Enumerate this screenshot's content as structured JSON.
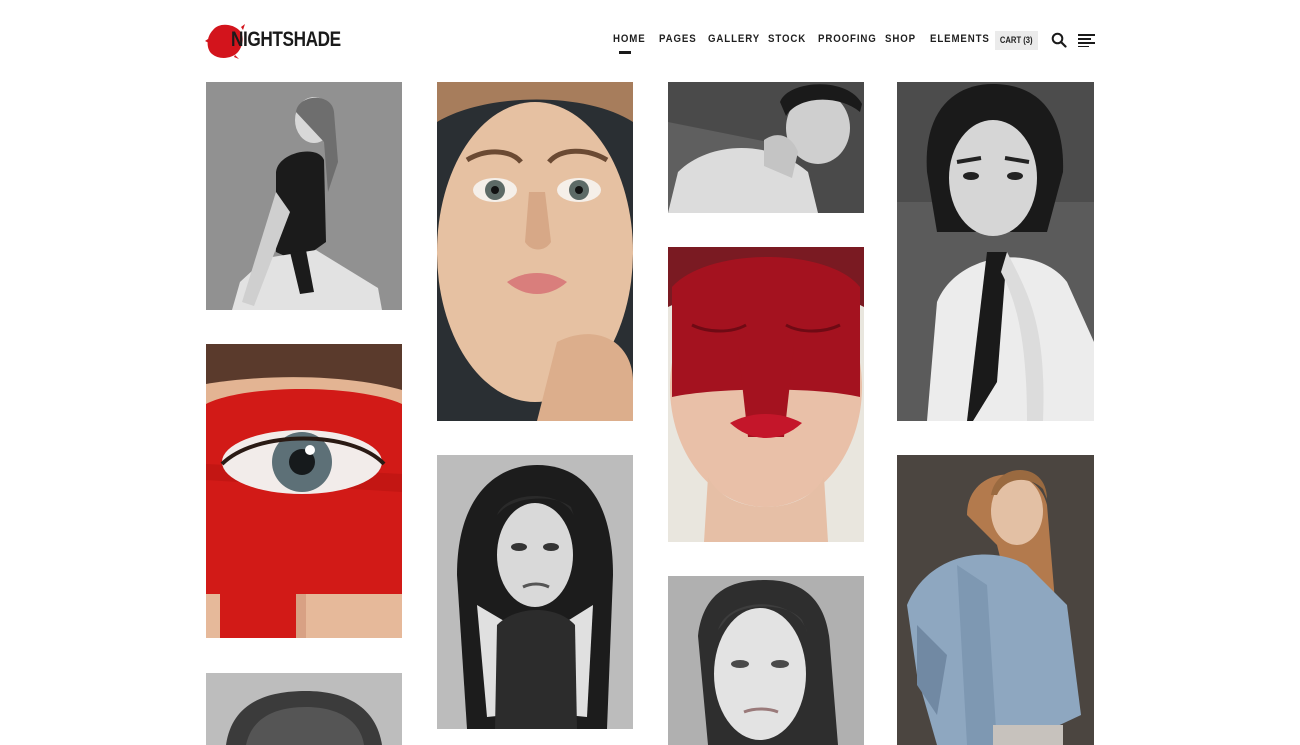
{
  "brand": {
    "name": "NIGHTSHADE",
    "accent_color": "#d3141c"
  },
  "nav": {
    "items": [
      "HOME",
      "PAGES",
      "GALLERY",
      "STOCK",
      "PROOFING",
      "SHOP",
      "ELEMENTS"
    ],
    "active": "HOME"
  },
  "header_actions": {
    "cart_label": "CART (3)",
    "search_icon": "search-icon",
    "menu_icon": "hamburger-menu-icon"
  },
  "gallery": {
    "layout": "masonry",
    "columns": 4,
    "photos": [
      {
        "id": "photo-1",
        "description": "black and white seated model",
        "tone": "grey"
      },
      {
        "id": "photo-2",
        "description": "close-up portrait",
        "tone": "color"
      },
      {
        "id": "photo-3",
        "description": "male model bare shoulder",
        "tone": "grey"
      },
      {
        "id": "photo-4",
        "description": "model in white shirt",
        "tone": "grey"
      },
      {
        "id": "photo-5",
        "description": "eye with red paint",
        "tone": "red"
      },
      {
        "id": "photo-6",
        "description": "red face paint closed eyes",
        "tone": "red"
      },
      {
        "id": "photo-7",
        "description": "model in hooded knit",
        "tone": "grey"
      },
      {
        "id": "photo-8",
        "description": "model in denim jacket",
        "tone": "color"
      },
      {
        "id": "photo-9",
        "description": "slicked hair portrait",
        "tone": "grey"
      },
      {
        "id": "photo-10",
        "description": "short hair top of head",
        "tone": "grey"
      }
    ]
  }
}
